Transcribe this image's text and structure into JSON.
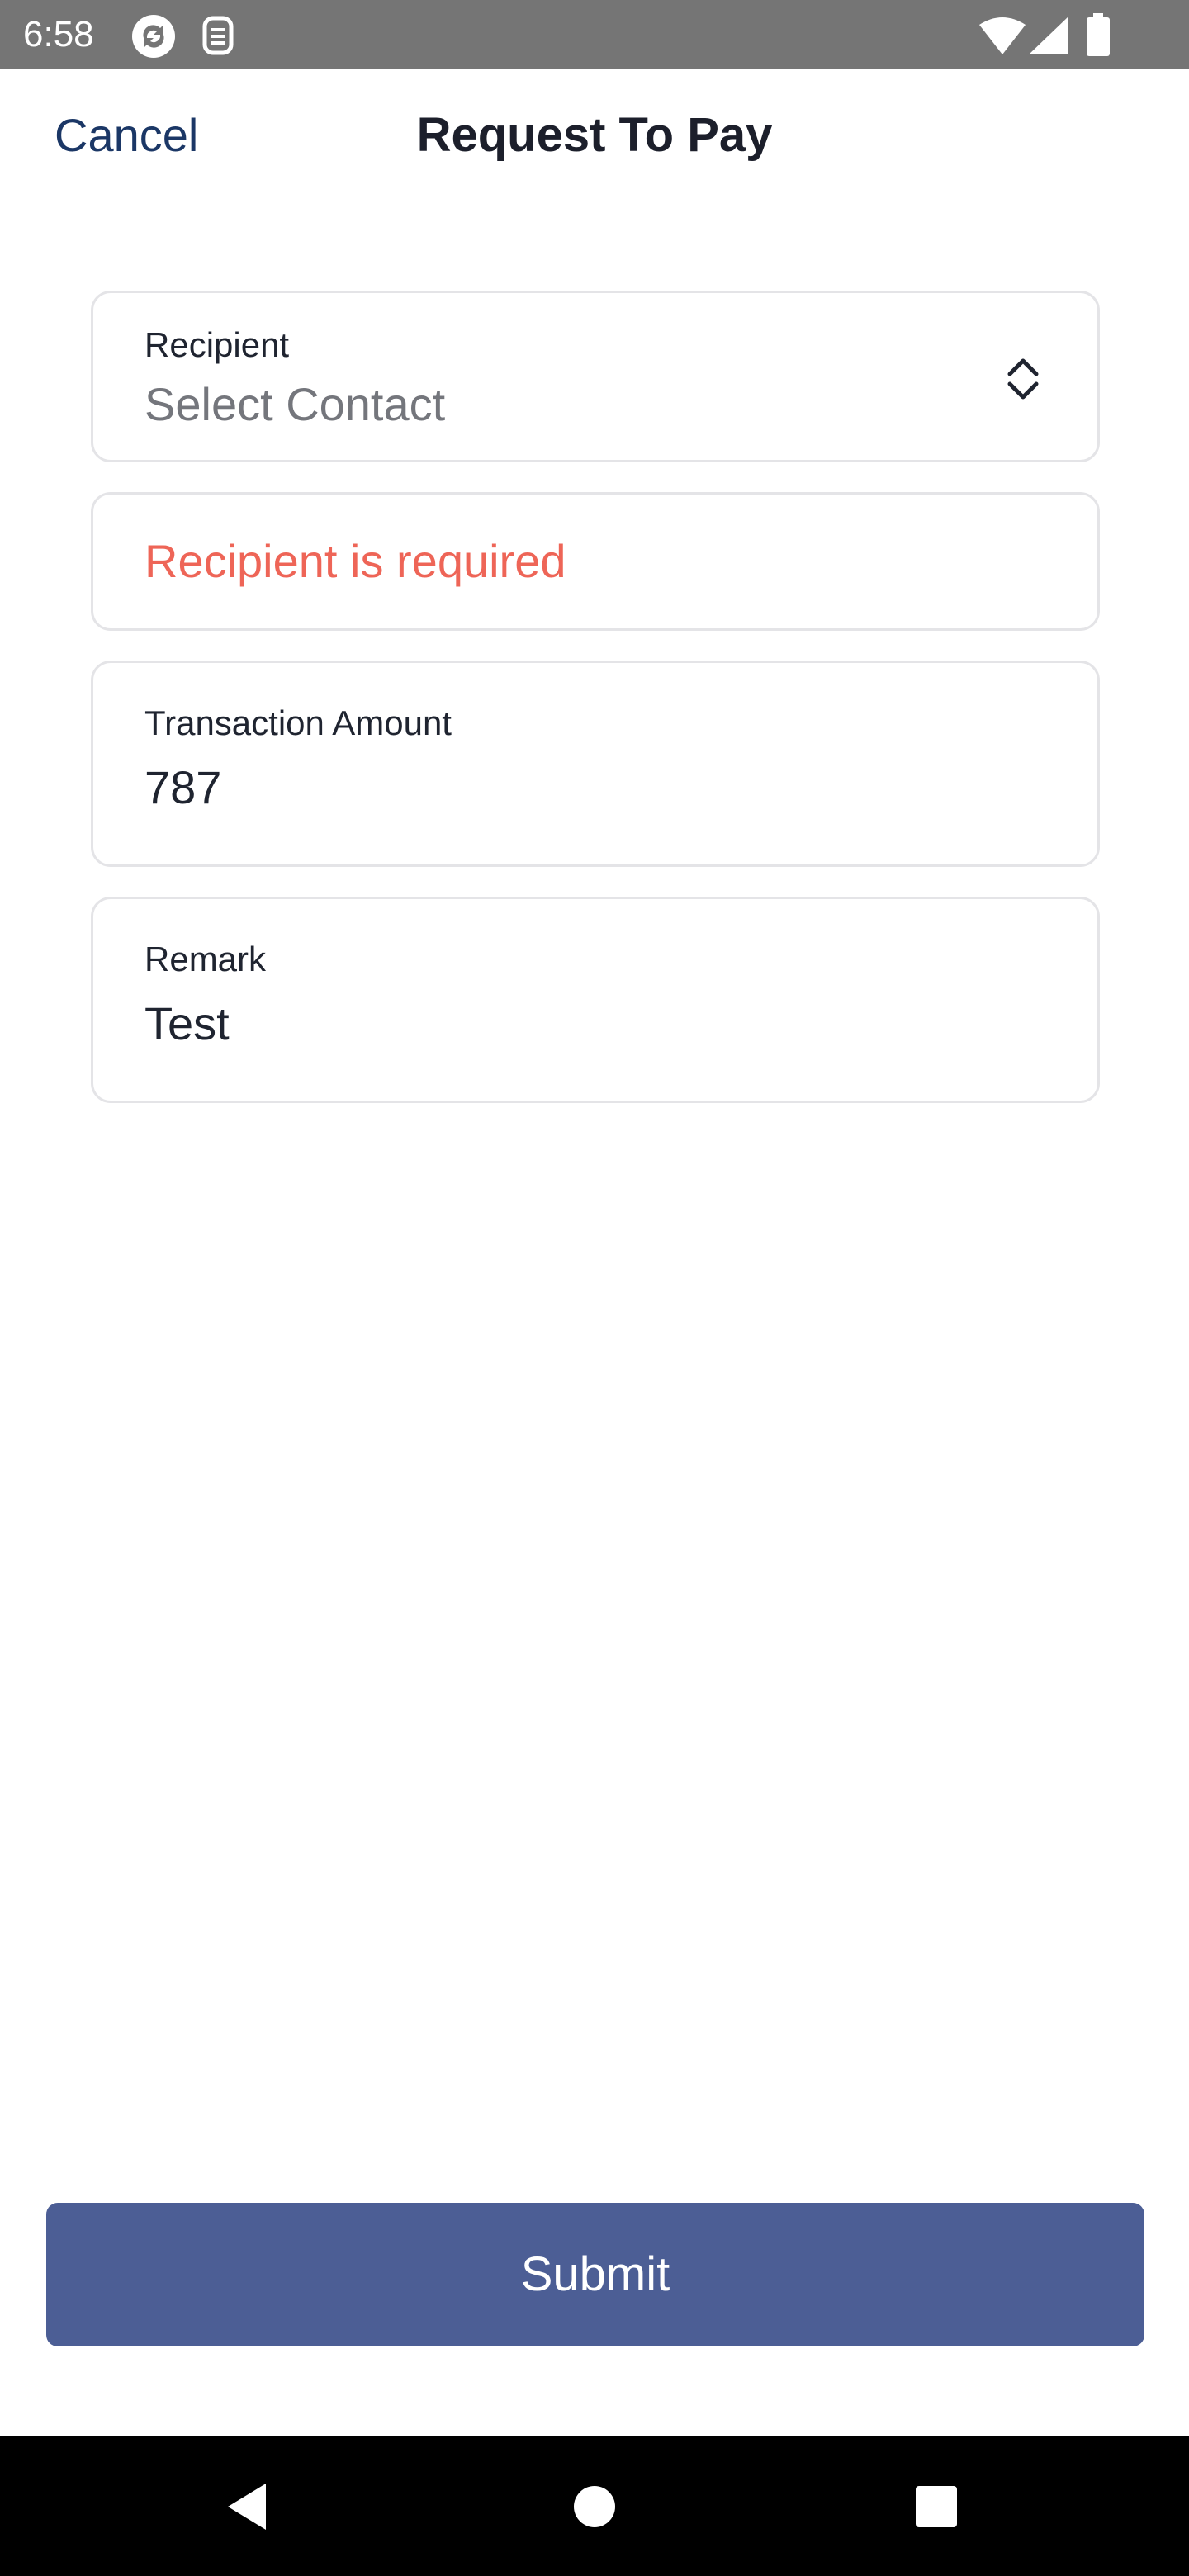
{
  "status_bar": {
    "time": "6:58",
    "icons": [
      "sync-icon",
      "sim-icon",
      "wifi-icon",
      "signal-icon",
      "battery-icon"
    ]
  },
  "header": {
    "cancel_label": "Cancel",
    "title": "Request To Pay"
  },
  "form": {
    "recipient": {
      "label": "Recipient",
      "placeholder": "Select Contact",
      "icon": "chevron-updown-icon"
    },
    "error_message": "Recipient is required",
    "amount": {
      "label": "Transaction Amount",
      "value": "787"
    },
    "remark": {
      "label": "Remark",
      "value": "Test"
    }
  },
  "submit_label": "Submit",
  "colors": {
    "accent": "#4c5e95",
    "cancel": "#1b3766",
    "error": "#ee6557",
    "border": "#e4e4e7"
  },
  "nav_bar": {
    "icons": [
      "back-icon",
      "home-icon",
      "recent-apps-icon"
    ]
  }
}
